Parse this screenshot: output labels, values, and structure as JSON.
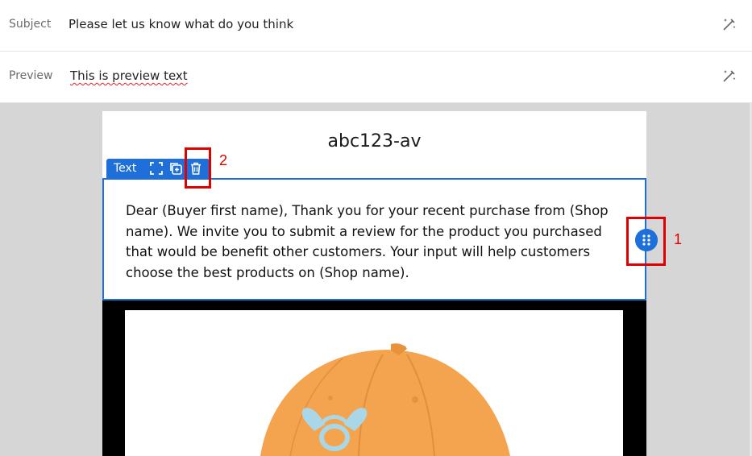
{
  "subject": {
    "label": "Subject",
    "value": "Please let us know what do you think",
    "icon": "magic-wand-icon"
  },
  "preview": {
    "label": "Preview",
    "value": "This is preview text",
    "icon": "magic-wand-icon"
  },
  "email": {
    "title": "abc123-av",
    "toolbar": {
      "label": "Text",
      "icons": [
        "expand-icon",
        "duplicate-icon",
        "trash-icon"
      ]
    },
    "body": "Dear (Buyer first name), Thank you for your recent purchase from (Shop name). We invite you to submit a review for the product you purchased that would be benefit other customers. Your input will help customers choose the best products on (Shop name).",
    "image_alt": "orange cap"
  },
  "annotations": {
    "marker1": "1",
    "marker2": "2"
  },
  "colors": {
    "accent": "#1e6fd9",
    "highlight": "#e00000",
    "canvas": "#d6d6d6",
    "cap": "#f4a44f"
  }
}
